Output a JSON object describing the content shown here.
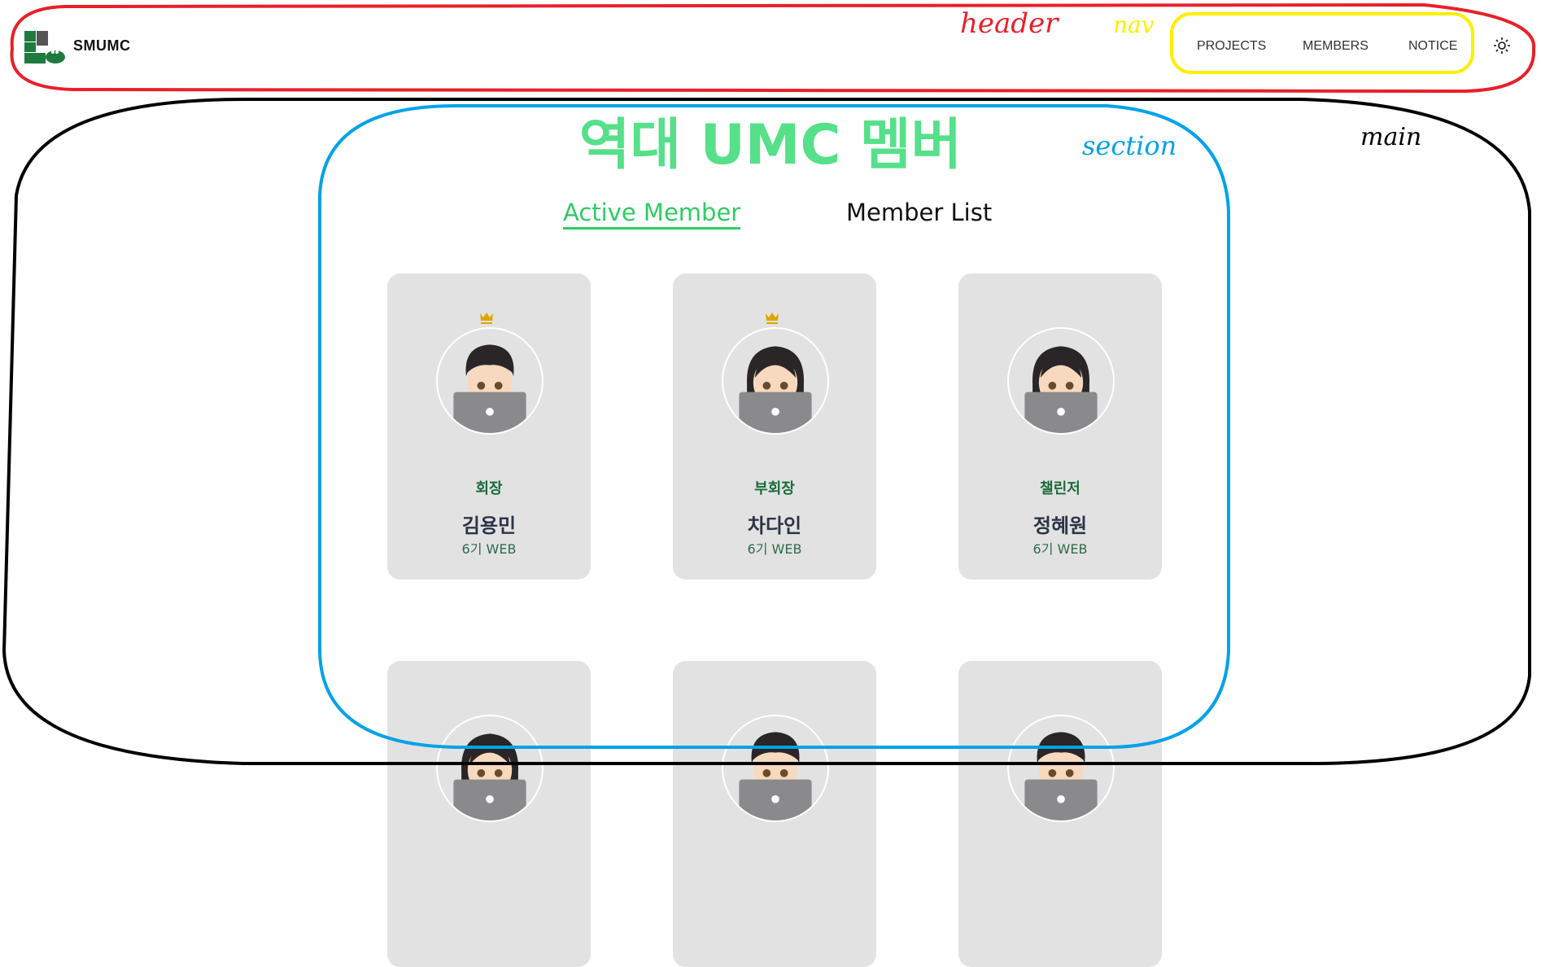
{
  "header": {
    "brand": "SMUMC",
    "nav": [
      "PROJECTS",
      "MEMBERS",
      "NOTICE"
    ],
    "theme_icon": "sun-icon"
  },
  "main": {
    "title": "역대 UMC 멤버",
    "tabs": {
      "active": "Active Member",
      "other": "Member List"
    }
  },
  "members": [
    {
      "role": "회장",
      "name": "김용민",
      "gen": "6기 WEB",
      "crown": true,
      "avatar": "male"
    },
    {
      "role": "부회장",
      "name": "차다인",
      "gen": "6기 WEB",
      "crown": true,
      "avatar": "female"
    },
    {
      "role": "챌린저",
      "name": "정혜원",
      "gen": "6기 WEB",
      "crown": false,
      "avatar": "female"
    },
    {
      "avatar": "female"
    },
    {
      "avatar": "male"
    },
    {
      "avatar": "male"
    }
  ],
  "annotations": {
    "header": "header",
    "nav": "nav",
    "section": "section",
    "main": "main"
  },
  "colors": {
    "accent": "#55e089",
    "tab_active": "#2ecc64",
    "card_bg": "#e3e2e3",
    "role": "#1a6b3a"
  }
}
